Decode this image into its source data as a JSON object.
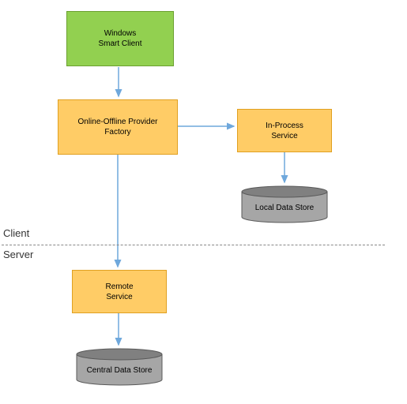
{
  "nodes": {
    "windows_client": {
      "line1": "Windows",
      "line2": "Smart Client"
    },
    "provider_factory": {
      "line1": "Online-Offline Provider",
      "line2": "Factory"
    },
    "inprocess_service": {
      "line1": "In-Process",
      "line2": "Service"
    },
    "remote_service": {
      "line1": "Remote",
      "line2": "Service"
    },
    "local_store": "Local Data Store",
    "central_store": "Central Data Store"
  },
  "zones": {
    "client": "Client",
    "server": "Server"
  },
  "colors": {
    "green_fill": "#92D050",
    "orange_fill": "#FFCC66",
    "arrow": "#6FA8DC",
    "cyl_fill": "#A6A6A6",
    "cyl_stroke": "#595959"
  }
}
